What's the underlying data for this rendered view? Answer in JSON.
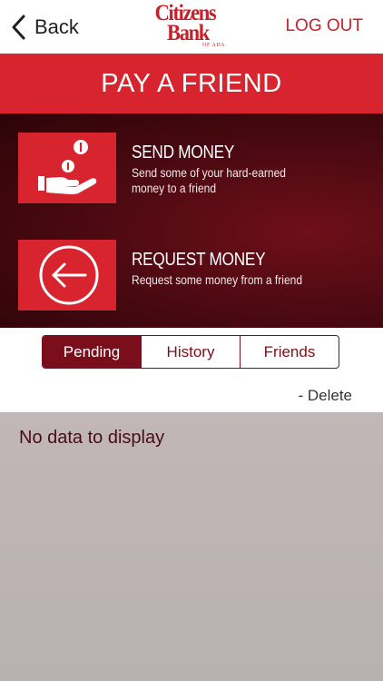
{
  "nav": {
    "back_label": "Back",
    "logo_line1": "Citizens",
    "logo_line2": "Bank",
    "logo_sub": "OF ADA",
    "logout_label": "LOG OUT"
  },
  "header": {
    "title": "PAY A FRIEND"
  },
  "actions": {
    "send": {
      "title": "SEND MONEY",
      "description": "Send some of your hard-earned money to a friend",
      "icon": "hand-with-coins-icon"
    },
    "request": {
      "title": "REQUEST MONEY",
      "description": "Request some money from a friend",
      "icon": "arrow-left-circle-icon"
    }
  },
  "tabs": {
    "items": [
      {
        "label": "Pending",
        "active": true
      },
      {
        "label": "History",
        "active": false
      },
      {
        "label": "Friends",
        "active": false
      }
    ]
  },
  "list": {
    "delete_label": "- Delete",
    "empty_message": "No data to display"
  },
  "colors": {
    "brand_red": "#d8242f",
    "dark_maroon": "#7a0f1b",
    "panel_dark": "#4f0a12",
    "content_bg": "#bdb4b3"
  }
}
